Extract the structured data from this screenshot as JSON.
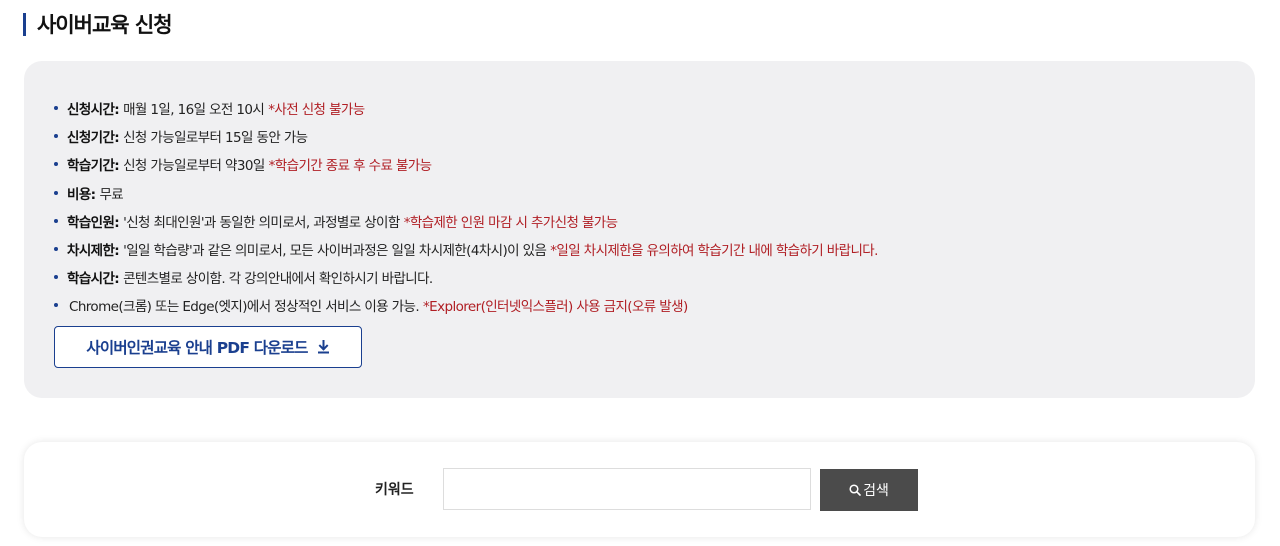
{
  "page": {
    "title": "사이버교육 신청"
  },
  "info": {
    "items": [
      {
        "label": "신청시간:",
        "desc": "매월 1일, 16일 오전 10시",
        "note": "*사전 신청 불가능"
      },
      {
        "label": "신청기간:",
        "desc": "신청 가능일로부터 15일 동안 가능",
        "note": ""
      },
      {
        "label": "학습기간:",
        "desc": "신청 가능일로부터 약30일",
        "note": "*학습기간 종료 후 수료 불가능"
      },
      {
        "label": "비용:",
        "desc": "무료",
        "note": ""
      },
      {
        "label": "학습인원:",
        "desc": "'신청 최대인원'과 동일한 의미로서, 과정별로 상이함",
        "note": "*학습제한 인원 마감 시 추가신청 불가능"
      },
      {
        "label": "차시제한:",
        "desc": "'일일 학습량'과 같은 의미로서, 모든 사이버과정은 일일 차시제한(4차시)이 있음",
        "note": "*일일 차시제한을 유의하여 학습기간 내에 학습하기 바랍니다."
      },
      {
        "label": "학습시간:",
        "desc": "콘텐츠별로 상이함. 각 강의안내에서 확인하시기 바랍니다.",
        "note": ""
      }
    ],
    "browser": {
      "desc": "Chrome(크롬) 또는 Edge(엣지)에서 정상적인 서비스 이용 가능.",
      "note": "*Explorer(인터넷익스플러) 사용 금지(오류 발생)"
    },
    "pdf_button": {
      "label": "사이버인권교육 안내 PDF 다운로드",
      "icon": "download-icon"
    }
  },
  "search": {
    "keyword_label": "키워드",
    "input_value": "",
    "input_placeholder": "",
    "button_label": "검색",
    "button_icon": "search-icon"
  },
  "colors": {
    "accent": "#1a3f8f",
    "note_red": "#b01e24",
    "panel_bg": "#f0f0f2",
    "search_button": "#4b4b4b"
  }
}
